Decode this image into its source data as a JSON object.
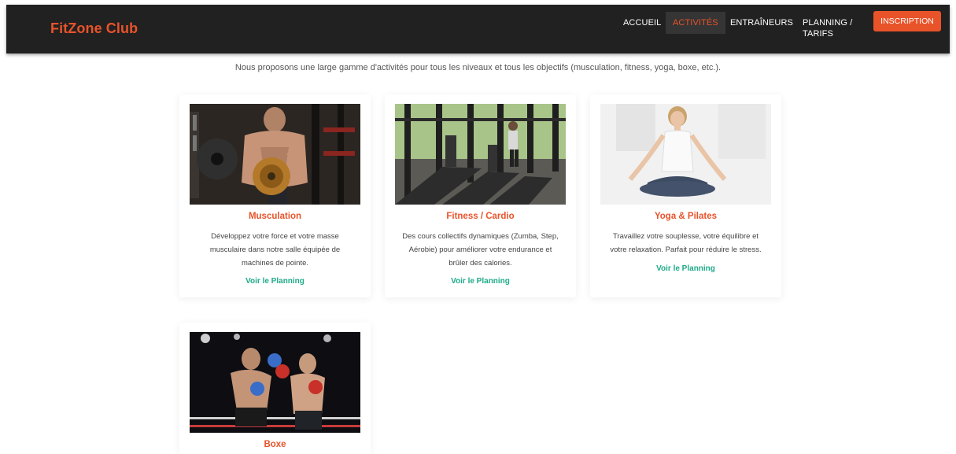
{
  "navbar": {
    "brand": "FitZone Club",
    "links": [
      {
        "label": "ACCUEIL"
      },
      {
        "label": "ACTIVITÉS"
      },
      {
        "label": "ENTRAÎNEURS"
      },
      {
        "label": "PLANNING / TARIFS"
      }
    ],
    "cta": "INSCRIPTION"
  },
  "intro": "Nous proposons une large gamme d'activités pour tous les niveaux et tous les objectifs (musculation, fitness, yoga, boxe, etc.).",
  "cards": [
    {
      "title": "Musculation",
      "description": "Développez votre force et votre masse musculaire dans notre salle équipée de machines de pointe.",
      "link": "Voir le Planning"
    },
    {
      "title": "Fitness / Cardio",
      "description": "Des cours collectifs dynamiques (Zumba, Step, Aérobie) pour améliorer votre endurance et brûler des calories.",
      "link": "Voir le Planning"
    },
    {
      "title": "Yoga & Pilates",
      "description": "Travaillez votre souplesse, votre équilibre et votre relaxation. Parfait pour réduire le stress.",
      "link": "Voir le Planning"
    },
    {
      "title": "Boxe"
    }
  ],
  "colors": {
    "accent": "#e8532a",
    "navbar_bg": "#212121",
    "link_green": "#1fab89"
  }
}
